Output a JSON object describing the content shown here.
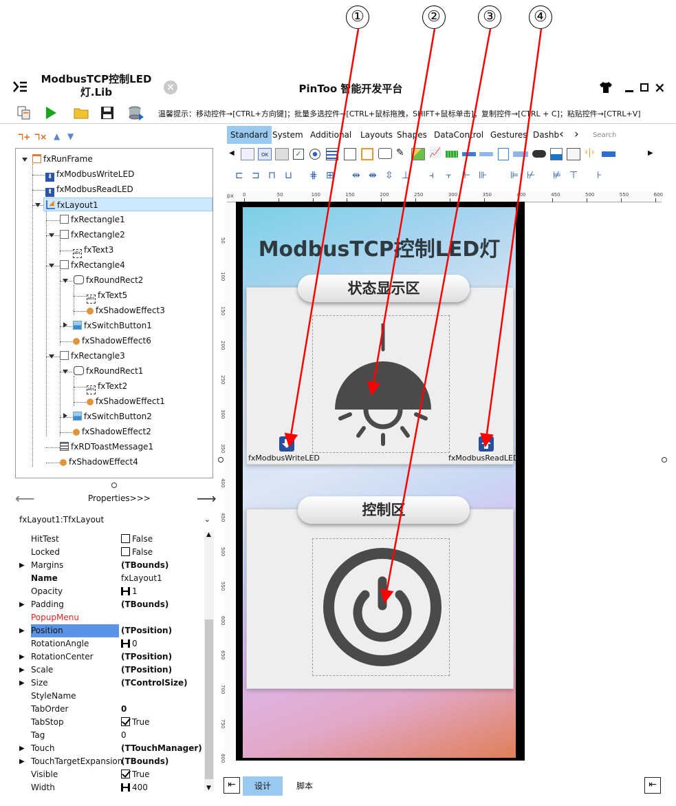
{
  "callouts": [
    "①",
    "②",
    "③",
    "④"
  ],
  "app": {
    "file_title": "ModbusTCP控制LED灯.Lib",
    "platform_title": "PinToo 智能开发平台"
  },
  "toolbar": {
    "hint": "温馨提示：移动控件→[CTRL+方向键]；批量多选控件→[CTRL+鼠标拖拽，SHIFT+鼠标单击]；复制控件→[CTRL + C]；粘贴控件→[CTRL+V]"
  },
  "tree": {
    "nodes": [
      {
        "label": "fxRunFrame",
        "icon": "frame-icon"
      },
      {
        "label": "fxModbusWriteLED",
        "icon": "download-icon"
      },
      {
        "label": "fxModbusReadLED",
        "icon": "upload-icon"
      },
      {
        "label": "fxLayout1",
        "icon": "layout-icon",
        "selected": true
      },
      {
        "label": "fxRectangle1",
        "icon": "rectangle-icon"
      },
      {
        "label": "fxRectangle2",
        "icon": "rectangle-icon"
      },
      {
        "label": "fxText3",
        "icon": "text-icon"
      },
      {
        "label": "fxRectangle4",
        "icon": "rectangle-icon"
      },
      {
        "label": "fxRoundRect2",
        "icon": "roundrect-icon"
      },
      {
        "label": "fxText5",
        "icon": "text-icon"
      },
      {
        "label": "fxShadowEffect3",
        "icon": "effect-icon"
      },
      {
        "label": "fxSwitchButton1",
        "icon": "switch-icon"
      },
      {
        "label": "fxShadowEffect6",
        "icon": "effect-icon"
      },
      {
        "label": "fxRectangle3",
        "icon": "rectangle-icon"
      },
      {
        "label": "fxRoundRect1",
        "icon": "roundrect-icon"
      },
      {
        "label": "fxText2",
        "icon": "text-icon"
      },
      {
        "label": "fxShadowEffect1",
        "icon": "effect-icon"
      },
      {
        "label": "fxSwitchButton2",
        "icon": "switch-icon"
      },
      {
        "label": "fxShadowEffect2",
        "icon": "effect-icon"
      },
      {
        "label": "fxRDToastMessage1",
        "icon": "toast-icon"
      },
      {
        "label": "fxShadowEffect4",
        "icon": "effect-icon"
      }
    ]
  },
  "properties": {
    "nav_label": "Properties>>>",
    "object": "fxLayout1:TfxLayout",
    "rows": [
      {
        "name": "HitTest",
        "value": "False",
        "kind": "check",
        "checked": false
      },
      {
        "name": "Locked",
        "value": "False",
        "kind": "check",
        "checked": false
      },
      {
        "name": "Margins",
        "value": "(TBounds)",
        "expandable": true,
        "bold": true
      },
      {
        "name": "Name",
        "value": "fxLayout1",
        "name_bold": true
      },
      {
        "name": "Opacity",
        "value": "1",
        "kind": "spin"
      },
      {
        "name": "Padding",
        "value": "(TBounds)",
        "expandable": true,
        "bold": true
      },
      {
        "name": "PopupMenu",
        "value": "",
        "red": true
      },
      {
        "name": "Position",
        "value": "(TPosition)",
        "expandable": true,
        "bold": true,
        "selected": true
      },
      {
        "name": "RotationAngle",
        "value": "0",
        "kind": "spin"
      },
      {
        "name": "RotationCenter",
        "value": "(TPosition)",
        "expandable": true,
        "bold": true
      },
      {
        "name": "Scale",
        "value": "(TPosition)",
        "expandable": true,
        "bold": true
      },
      {
        "name": "Size",
        "value": "(TControlSize)",
        "expandable": true,
        "bold": true
      },
      {
        "name": "StyleName",
        "value": ""
      },
      {
        "name": "TabOrder",
        "value": "0",
        "bold": true
      },
      {
        "name": "TabStop",
        "value": "True",
        "kind": "check",
        "checked": true
      },
      {
        "name": "Tag",
        "value": "0"
      },
      {
        "name": "Touch",
        "value": "(TTouchManager)",
        "expandable": true,
        "bold": true
      },
      {
        "name": "TouchTargetExpansion",
        "value": "(TBounds)",
        "expandable": true,
        "bold": true
      },
      {
        "name": "Visible",
        "value": "True",
        "kind": "check",
        "checked": true
      },
      {
        "name": "Width",
        "value": "400",
        "kind": "spin"
      }
    ]
  },
  "palette": {
    "tabs": [
      "Standard",
      "System",
      "Additional",
      "Layouts",
      "Shapes",
      "DataControl",
      "Gestures",
      "Dashb"
    ],
    "active_tab": "Standard",
    "search_placeholder": "Search"
  },
  "ruler": {
    "unit": "px",
    "h_ticks": [
      "0",
      "50",
      "100",
      "150",
      "200",
      "250",
      "300",
      "350",
      "400",
      "450",
      "500",
      "550",
      "600"
    ],
    "v_ticks": [
      "50",
      "100",
      "150",
      "200",
      "250",
      "300",
      "350",
      "400",
      "450",
      "500",
      "550",
      "600",
      "650",
      "700",
      "750",
      "800"
    ]
  },
  "design": {
    "title": "ModbusTCP控制LED灯",
    "status_section": "状态显示区",
    "control_section": "控制区",
    "write_label": "fxModbusWriteLED",
    "read_label": "fxModbusReadLED"
  },
  "bottom": {
    "design_tab": "设计",
    "script_tab": "脚本"
  },
  "colors": {
    "accent": "#2f5fb8",
    "selection": "#cde8ff",
    "annotation": "#ff0000",
    "active_tab": "#99c9ef"
  }
}
